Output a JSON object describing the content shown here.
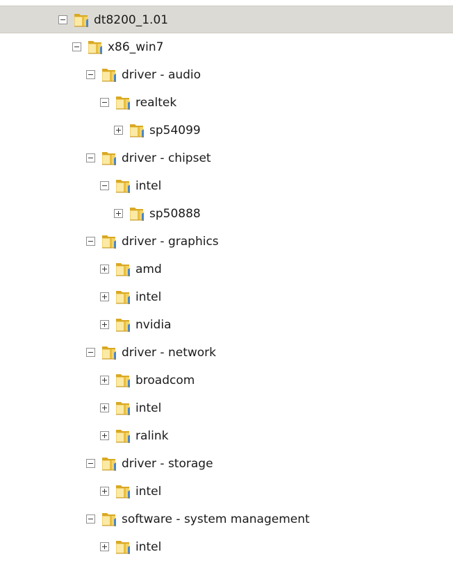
{
  "tree": {
    "items": [
      {
        "label": "dt8200_1.01",
        "depth": 0,
        "expanded": true,
        "selected": true,
        "icon": "folder-icon"
      },
      {
        "label": "x86_win7",
        "depth": 1,
        "expanded": true,
        "icon": "folder-icon"
      },
      {
        "label": "driver - audio",
        "depth": 2,
        "expanded": true,
        "icon": "folder-icon"
      },
      {
        "label": "realtek",
        "depth": 3,
        "expanded": true,
        "icon": "folder-icon"
      },
      {
        "label": "sp54099",
        "depth": 4,
        "expanded": false,
        "icon": "folder-icon"
      },
      {
        "label": "driver - chipset",
        "depth": 2,
        "expanded": true,
        "icon": "folder-icon"
      },
      {
        "label": "intel",
        "depth": 3,
        "expanded": true,
        "icon": "folder-icon"
      },
      {
        "label": "sp50888",
        "depth": 4,
        "expanded": false,
        "icon": "folder-icon"
      },
      {
        "label": "driver - graphics",
        "depth": 2,
        "expanded": true,
        "icon": "folder-icon"
      },
      {
        "label": "amd",
        "depth": 3,
        "expanded": false,
        "icon": "folder-icon"
      },
      {
        "label": "intel",
        "depth": 3,
        "expanded": false,
        "icon": "folder-icon"
      },
      {
        "label": "nvidia",
        "depth": 3,
        "expanded": false,
        "icon": "folder-icon"
      },
      {
        "label": "driver - network",
        "depth": 2,
        "expanded": true,
        "icon": "folder-icon"
      },
      {
        "label": "broadcom",
        "depth": 3,
        "expanded": false,
        "icon": "folder-icon"
      },
      {
        "label": "intel",
        "depth": 3,
        "expanded": false,
        "icon": "folder-icon"
      },
      {
        "label": "ralink",
        "depth": 3,
        "expanded": false,
        "icon": "folder-icon"
      },
      {
        "label": "driver - storage",
        "depth": 2,
        "expanded": true,
        "icon": "folder-icon"
      },
      {
        "label": "intel",
        "depth": 3,
        "expanded": false,
        "icon": "folder-icon"
      },
      {
        "label": "software - system management",
        "depth": 2,
        "expanded": true,
        "icon": "folder-icon"
      },
      {
        "label": "intel",
        "depth": 3,
        "expanded": false,
        "icon": "folder-icon"
      }
    ]
  },
  "colors": {
    "selected_background": "#dcdad5",
    "folder_body": "#f2d36b",
    "folder_light": "#fbe9a6",
    "folder_dark": "#d9a823",
    "folder_blue_stripe": "#4a86c8"
  }
}
